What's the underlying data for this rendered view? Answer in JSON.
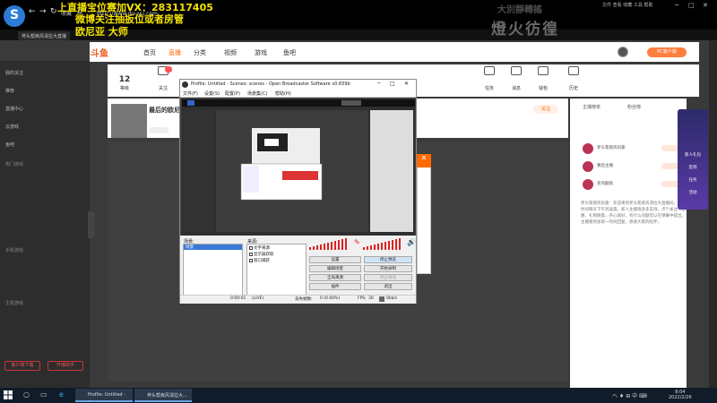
{
  "overlay": {
    "line1": "上直播宝位赛加VX：283117405",
    "line2": "微博关注抽扳位或者房管",
    "line3": "欧尼亚 大师",
    "right_big": "燈火彷徨",
    "right_small": "大別靜轉謠"
  },
  "browser": {
    "url": "http://www.douyu.com",
    "tab1": "斧头帮疾风凛拉大直播",
    "menu": [
      "文件",
      "查看",
      "收藏",
      "工具",
      "帮助"
    ],
    "back": "←",
    "forward": "→",
    "refresh": "↻",
    "home": "⌂",
    "favorites_label": "收藏"
  },
  "douyu": {
    "logo": "斗鱼",
    "nav": [
      "首页",
      "直播",
      "分类",
      "视频",
      "游戏",
      "鱼吧"
    ],
    "pc_client": "PC客户端",
    "stats": [
      {
        "value": "12",
        "label": "等级"
      },
      {
        "label": "关注"
      },
      {
        "label": "历史"
      },
      {
        "label": "任务"
      },
      {
        "label": "消息"
      },
      {
        "label": "钱包"
      }
    ],
    "room_title": "最后的欧尼亚大师",
    "follow": "关注",
    "right_tabs": [
      "主播榜单",
      "粉丝榜"
    ],
    "right_rows": [
      {
        "name": "斧头帮疾风剑豪"
      },
      {
        "name": "赛后主播"
      },
      {
        "name": "逆风翻盘"
      }
    ],
    "right_text": "斧头帮疾风剑豪：欢迎来到斧头帮疾风凛拉大直播间，直播时间每天下午到凌晨，新人主播请多多支持，点个关注不迷路，礼物随意，开心就好，有什么问题可以在弹幕中提出，主播看到会第一时间回复，感谢大家的陪伴。",
    "float_widget": [
      "新人礼包",
      "签到",
      "任务",
      "活动"
    ]
  },
  "sidebar": {
    "items": [
      "我的关注",
      "推荐",
      "直播中心",
      "云游戏",
      "鱼吧"
    ],
    "section1": "热门游戏",
    "section2": "手机游戏",
    "section3": "主机游戏",
    "btn1": "客户端下载",
    "btn2": "开播助手"
  },
  "obs": {
    "title": "Profile: Untitled - Scenes: scenes - Open Broadcaster Software v0.659b",
    "menu": [
      "文件(F)",
      "设置(S)",
      "配置(P)",
      "场景集(C)",
      "帮助(H)"
    ],
    "scene_label": "场景:",
    "source_label": "来源:",
    "scene_item": "场景",
    "sources": [
      "文字来源",
      "显示器获取",
      "窗口捕获"
    ],
    "buttons": {
      "settings": "设置",
      "stop_preview": "停止预览",
      "edit_scene": "编辑场景",
      "start_record": "开始录制",
      "global_sources": "全局来源",
      "plugins": "插件",
      "stop_stream": "停止串流",
      "exit": "退出"
    },
    "status": {
      "time": "0:00:01",
      "rate": "(LIVE)",
      "dropped": "丢失帧数:",
      "dropped_value": "0 (0.00%)",
      "fps_label": "FPS:",
      "fps": "30",
      "bitrate": "0kb/s"
    },
    "close": "✕",
    "max": "□",
    "min": "─"
  },
  "taskbar": {
    "apps": [
      "Profile: Untitled - ...",
      "斧头帮疾风凛拉大..."
    ],
    "time": "8:04",
    "date": "2022/2/26",
    "tray": "ヘ ♦ ⊞ 中 ⌨"
  },
  "colors": {
    "accent": "#ff6a00",
    "overlay_text": "#f5e400",
    "obs_meter": "#d22222",
    "taskbar": "#101c2a"
  }
}
